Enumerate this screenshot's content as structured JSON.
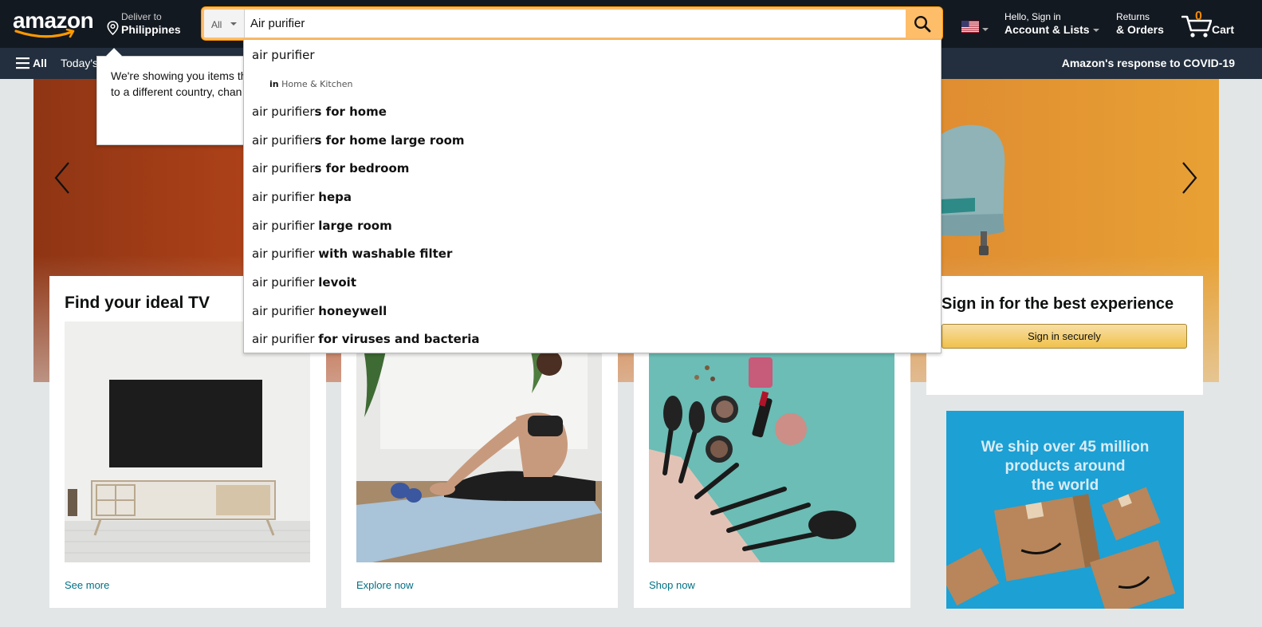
{
  "header": {
    "logo_text": "amazon",
    "deliver_line1": "Deliver to",
    "deliver_line2": "Philippines",
    "search": {
      "category": "All",
      "value": "Air purifier"
    },
    "account_line1": "Hello, Sign in",
    "account_line2": "Account & Lists",
    "orders_line1": "Returns",
    "orders_line2": "& Orders",
    "cart_count": "0",
    "cart_label": "Cart"
  },
  "subnav": {
    "all_label": "All",
    "todays_label": "Today's",
    "covid_label": "Amazon's response to COVID-19"
  },
  "popover": {
    "line1": "We're showing you items th",
    "line2": "to a different country, chan"
  },
  "suggestions": {
    "first": "air purifier",
    "department": {
      "prefix": "in",
      "name": "Home & Kitchen"
    },
    "items": [
      {
        "typed": "air purifier",
        "completion": "s for home"
      },
      {
        "typed": "air purifier",
        "completion": "s for home large room"
      },
      {
        "typed": "air purifier",
        "completion": "s for bedroom"
      },
      {
        "typed": "air purifier ",
        "completion": "hepa"
      },
      {
        "typed": "air purifier ",
        "completion": "large room"
      },
      {
        "typed": "air purifier ",
        "completion": "with washable filter"
      },
      {
        "typed": "air purifier ",
        "completion": "levoit"
      },
      {
        "typed": "air purifier ",
        "completion": "honeywell"
      },
      {
        "typed": "air purifier ",
        "completion": "for viruses and bacteria"
      }
    ]
  },
  "cards": {
    "tv": {
      "title": "Find your ideal TV",
      "link": "See more"
    },
    "fitness": {
      "link": "Explore now"
    },
    "beauty": {
      "link": "Shop now"
    },
    "signin": {
      "title": "Sign in for the best experience",
      "button": "Sign in securely"
    },
    "ship_ad": {
      "line1": "We ship over 45 million",
      "line2": "products around",
      "line3": "the world"
    }
  },
  "colors": {
    "nav_top": "#131921",
    "nav_bottom": "#232f3e",
    "search_button": "#febd69",
    "link": "#007185",
    "cart_count": "#f08804"
  },
  "icons": [
    "location-pin-icon",
    "search-icon",
    "us-flag-icon",
    "cart-icon",
    "hamburger-menu-icon",
    "chevron-left-icon",
    "chevron-right-icon"
  ]
}
